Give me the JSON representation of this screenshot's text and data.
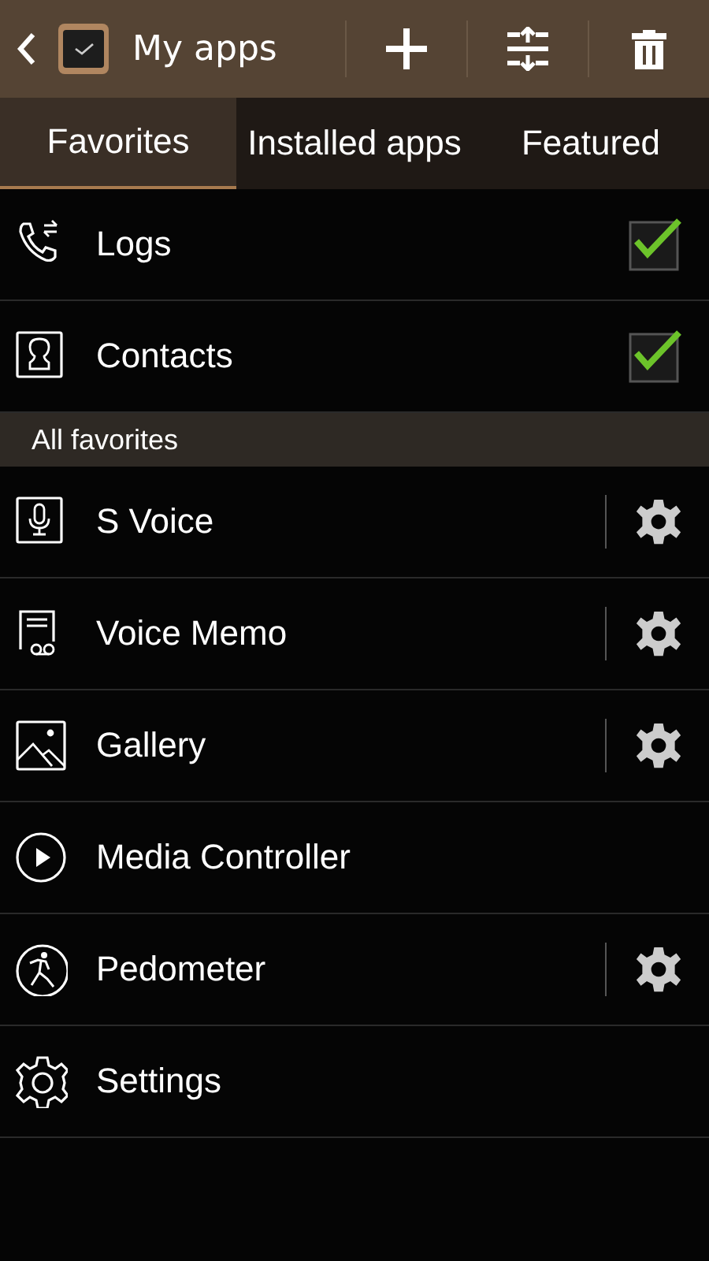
{
  "header": {
    "title": "My apps"
  },
  "tabs": [
    {
      "label": "Favorites",
      "selected": true
    },
    {
      "label": "Installed apps",
      "selected": false
    },
    {
      "label": "Featured",
      "selected": false
    }
  ],
  "favorites": [
    {
      "name": "Logs",
      "checked": true
    },
    {
      "name": "Contacts",
      "checked": true
    }
  ],
  "section": {
    "label": "All favorites"
  },
  "apps": [
    {
      "name": "S Voice",
      "has_settings": true
    },
    {
      "name": "Voice Memo",
      "has_settings": true
    },
    {
      "name": "Gallery",
      "has_settings": true
    },
    {
      "name": "Media Controller",
      "has_settings": false
    },
    {
      "name": "Pedometer",
      "has_settings": true
    },
    {
      "name": "Settings",
      "has_settings": false
    }
  ]
}
